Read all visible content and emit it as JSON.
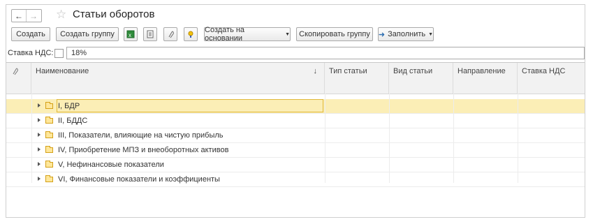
{
  "window": {
    "title": "Статьи оборотов"
  },
  "toolbar": {
    "create": "Создать",
    "create_group": "Создать группу",
    "create_based_on": "Создать на основании",
    "copy_group": "Скопировать группу",
    "fill": "Заполнить"
  },
  "vat": {
    "label": "Ставка НДС:",
    "value": "18%"
  },
  "table": {
    "columns": [
      "Наименование",
      "Тип статьи",
      "Вид статьи",
      "Направление",
      "Ставка НДС"
    ],
    "sort_indicator": "↓",
    "rows": [
      "I, БДР",
      "II, БДДС",
      "III, Показатели, влияющие на чистую прибыль",
      "IV, Приобретение МПЗ и внеоборотных активов",
      "V, Нефинансовые показатели",
      "VI, Финансовые показатели и коэффициенты"
    ],
    "selected_row": 0
  },
  "icons": [
    "arrow-left-icon",
    "arrow-right-icon",
    "star-icon",
    "excel-icon",
    "list-icon",
    "paperclip-icon",
    "bulb-icon",
    "fill-arrow-icon",
    "dropdown-icon",
    "folder-icon",
    "expand-icon"
  ]
}
